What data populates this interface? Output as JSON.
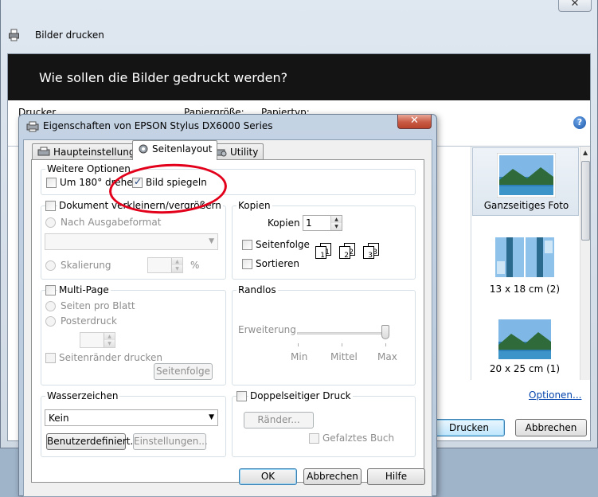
{
  "background_window": {
    "title": "Bilder drucken",
    "close_glyph": "✕",
    "header": "Wie sollen die Bilder gedruckt werden?",
    "labels": {
      "drucker": "Drucker",
      "papiergroesse": "Papiergröße:",
      "papiertyp": "Papiertyp:"
    },
    "thumbnails": [
      {
        "label": "Ganzseitiges Foto",
        "selected": true
      },
      {
        "label": "13 x 18 cm (2)",
        "selected": false
      },
      {
        "label": "20 x 25 cm (1)",
        "selected": false
      }
    ],
    "options_link": "Optionen...",
    "print_button": "Drucken",
    "cancel_button": "Abbrechen"
  },
  "dialog": {
    "title": "Eigenschaften von EPSON Stylus DX6000 Series",
    "close_glyph": "✕",
    "tabs": [
      {
        "label": "Haupteinstellungen",
        "active": false
      },
      {
        "label": "Seitenlayout",
        "active": true
      },
      {
        "label": "Utility",
        "active": false
      }
    ],
    "weitere_optionen": {
      "title": "Weitere Optionen",
      "rotate": {
        "label": "Um 180° drehen",
        "checked": false
      },
      "mirror": {
        "label": "Bild spiegeln",
        "checked": true
      }
    },
    "scale": {
      "title": "Dokument verkleinern/vergrößern",
      "option_format": "Nach Ausgabeformat",
      "option_scaling": "Skalierung",
      "percent": "%"
    },
    "copies": {
      "title": "Kopien",
      "label": "Kopien",
      "value": "1",
      "collate_label": "Seitenfolge",
      "sort_label": "Sortieren",
      "stack_numbers": [
        "1",
        "1",
        "2",
        "2",
        "3",
        "3"
      ]
    },
    "multipage": {
      "title": "Multi-Page",
      "pages_per_sheet": "Seiten pro Blatt",
      "poster": "Posterdruck",
      "borders": "Seitenränder drucken",
      "order_button": "Seitenfolge"
    },
    "borderless": {
      "title": "Randlos",
      "expansion": "Erweiterung",
      "level": "Max",
      "ticks": [
        "Min",
        "Mittel",
        "Max"
      ]
    },
    "watermark": {
      "title": "Wasserzeichen",
      "value": "Kein",
      "custom_button": "Benutzerdefiniert...",
      "settings_button": "Einstellungen..."
    },
    "duplex": {
      "title": "Doppelseitiger Druck",
      "margins_button": "Ränder...",
      "folded": "Gefalztes Buch"
    },
    "buttons": {
      "ok": "OK",
      "cancel": "Abbrechen",
      "help": "Hilfe"
    }
  },
  "icons": [
    "printer-icon",
    "help-icon",
    "close-icon",
    "dropdown-arrow-icon",
    "spin-up-icon",
    "spin-down-icon",
    "collate-stack-icon"
  ]
}
